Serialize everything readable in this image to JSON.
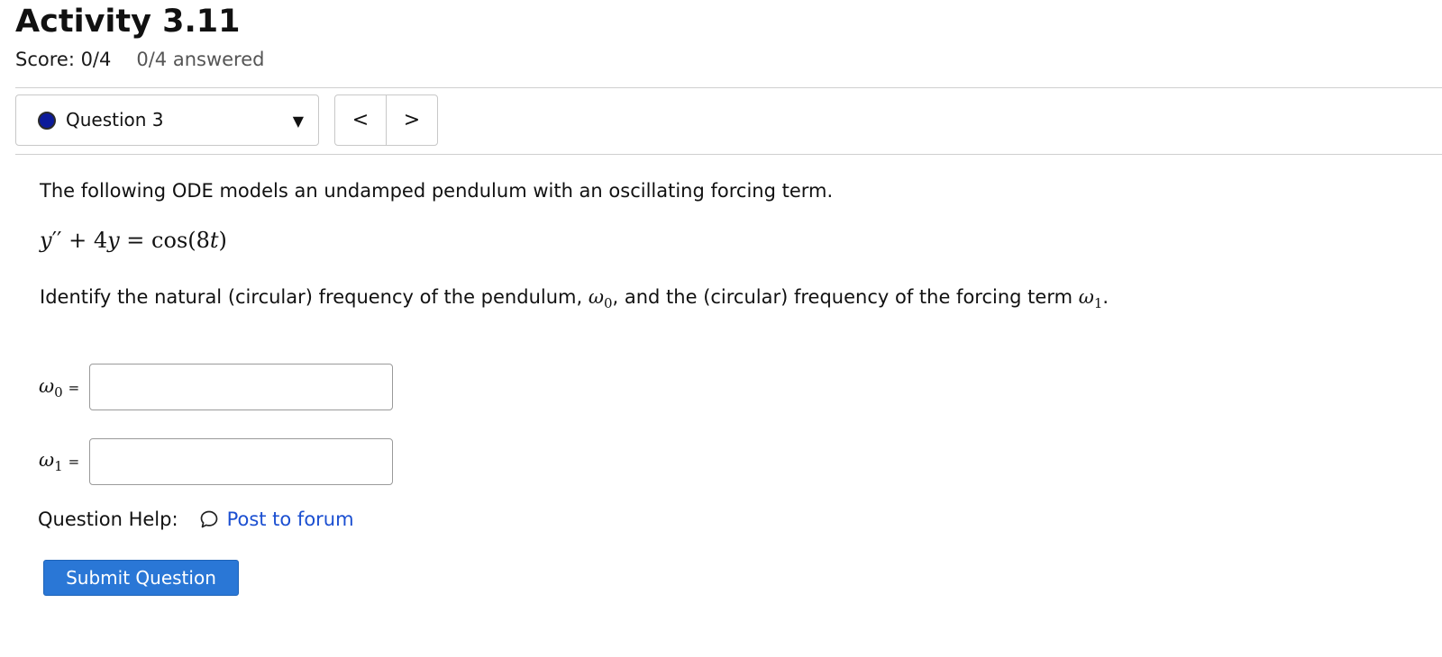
{
  "header": {
    "title": "Activity 3.11",
    "score": "Score: 0/4",
    "answered": "0/4 answered"
  },
  "question_nav": {
    "selected": "Question 3",
    "status_color": "#0c1a9a",
    "prev_label": "<",
    "next_label": ">",
    "caret_icon": "caret-down-icon"
  },
  "question": {
    "intro": "The following ODE models an undamped pendulum with an oscillating forcing term.",
    "equation": {
      "lhs_var": "y",
      "primes": "′′",
      "plus_term": " + 4",
      "var2": "y",
      "equals": " = ",
      "rhs_func": "cos(8",
      "rhs_var": "t",
      "rhs_close": ")"
    },
    "prompt_part1": "Identify the natural (circular) frequency of the pendulum, ",
    "prompt_part2": ", and the (circular) frequency of the forcing term ",
    "prompt_end": ".",
    "omega": "ω",
    "sub0": "0",
    "sub1": "1"
  },
  "fields": [
    {
      "symbol": "ω",
      "subscript": "0",
      "equals": "=",
      "value": ""
    },
    {
      "symbol": "ω",
      "subscript": "1",
      "equals": "=",
      "value": ""
    }
  ],
  "help": {
    "label": "Question Help:",
    "link": "Post to forum",
    "icon": "speech-bubble-icon"
  },
  "submit_label": "Submit Question",
  "colors": {
    "link": "#1b4fd1",
    "submit_bg": "#2a77d6"
  }
}
